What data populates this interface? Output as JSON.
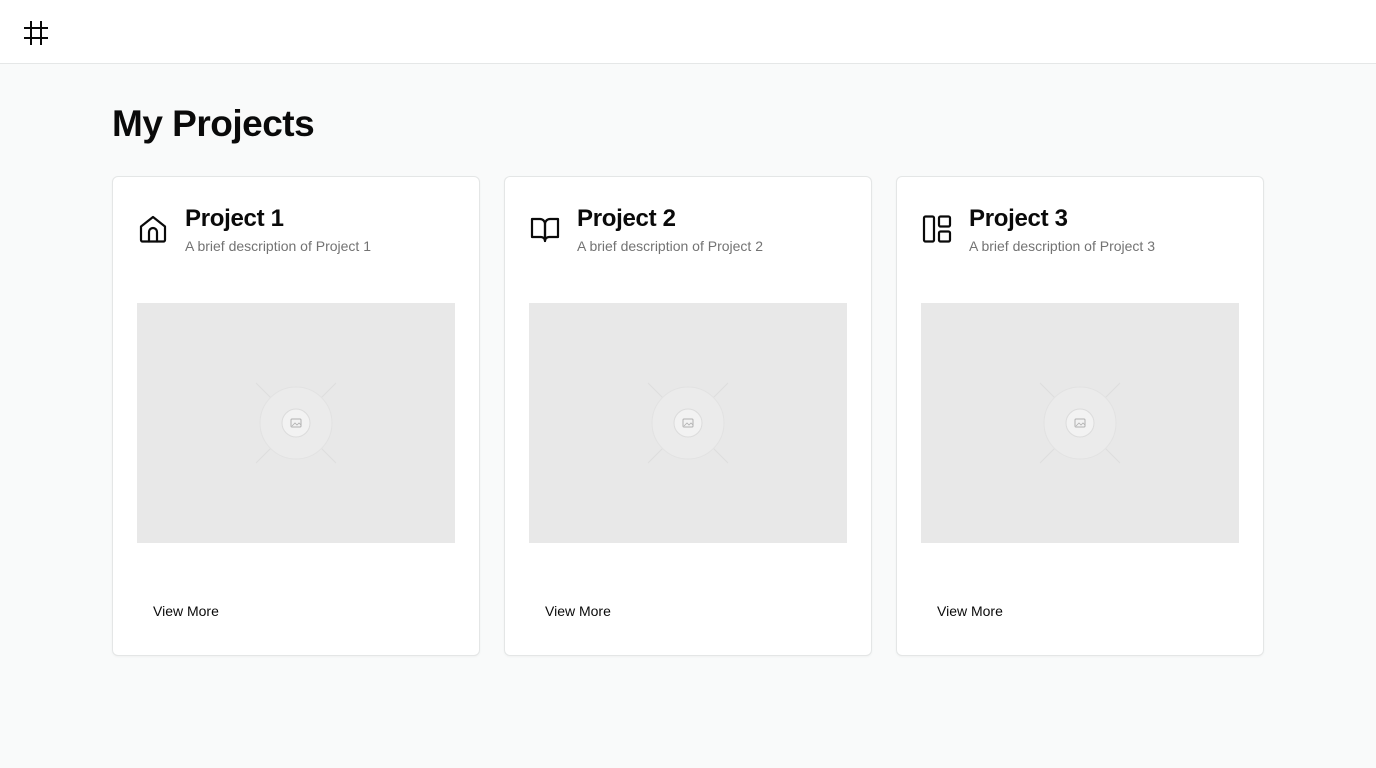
{
  "header": {
    "logo_icon": "hash-icon"
  },
  "page": {
    "title": "My Projects"
  },
  "projects": [
    {
      "title": "Project 1",
      "description": "A brief description of Project 1",
      "icon": "home-icon",
      "cta": "View More"
    },
    {
      "title": "Project 2",
      "description": "A brief description of Project 2",
      "icon": "book-open-icon",
      "cta": "View More"
    },
    {
      "title": "Project 3",
      "description": "A brief description of Project 3",
      "icon": "layout-panel-icon",
      "cta": "View More"
    }
  ],
  "colors": {
    "page_background": "#f9fafa",
    "card_background": "#ffffff",
    "image_placeholder": "#e8e8e8",
    "muted_text": "#737373",
    "text": "#0a0a0a"
  }
}
